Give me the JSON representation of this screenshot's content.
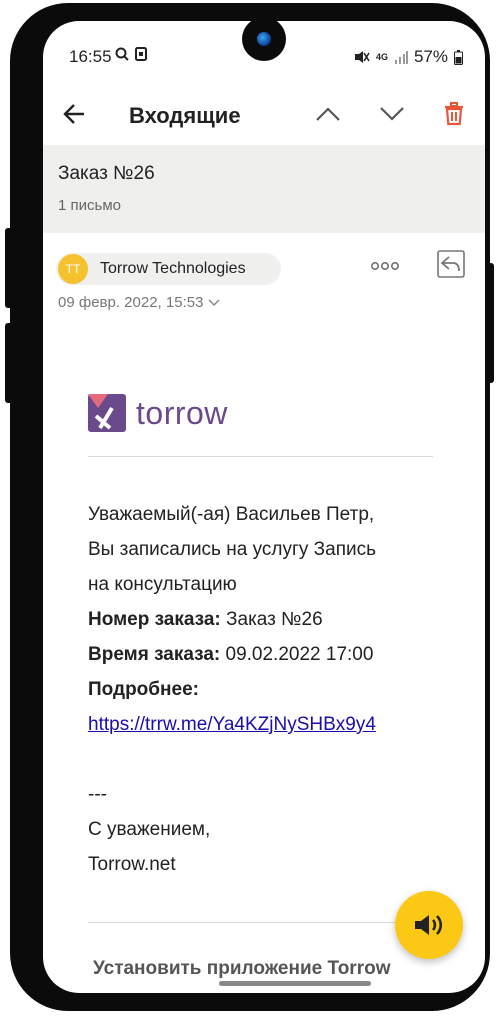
{
  "status": {
    "time": "16:55",
    "network": "4G",
    "battery": "57%"
  },
  "header": {
    "title": "Входящие"
  },
  "message": {
    "subject": "Заказ №26",
    "count": "1 письмо",
    "sender_initials": "TT",
    "sender_name": "Torrow Technologies",
    "date": "09 февр. 2022, 15:53"
  },
  "email": {
    "logo_text": "torrow",
    "greeting_line1": "Уважаемый(-ая) Васильев Петр,",
    "greeting_line2": "Вы записались на услугу Запись",
    "greeting_line3": "на консультацию",
    "order_number_label": "Номер заказа:",
    "order_number_value": " Заказ №26",
    "order_time_label": "Время заказа:",
    "order_time_value": " 09.02.2022 17:00",
    "details_label": "Подробнее:",
    "details_link": "https://trrw.me/Ya4KZjNySHBx9y4",
    "separator": "---",
    "regards": "С уважением,",
    "signature": "Torrow.net",
    "install_app_cut": "Установить приложение Torrow"
  },
  "colors": {
    "delete_icon": "#e8563a",
    "avatar": "#f5c12e",
    "fab": "#fcc816",
    "logo": "#6b4a8c",
    "link": "#1a0dab"
  },
  "icons": [
    "search-icon",
    "screenshot-icon",
    "mute-icon",
    "signal-icon",
    "battery-icon",
    "back-arrow-icon",
    "chevron-up-icon",
    "chevron-down-icon",
    "trash-icon",
    "more-icon",
    "reply-icon",
    "speaker-icon"
  ]
}
